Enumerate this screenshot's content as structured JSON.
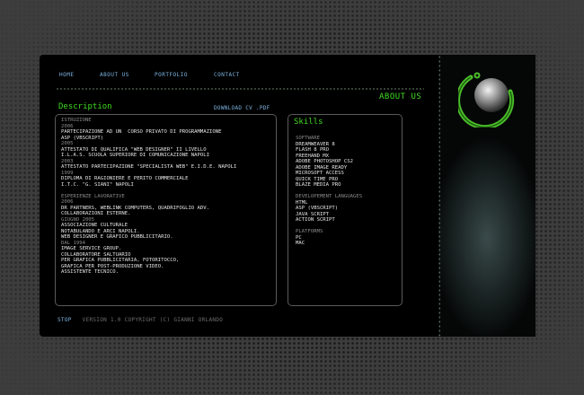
{
  "nav": {
    "items": [
      "HOME",
      "ABOUT US",
      "PORTFOLIO",
      "CONTACT"
    ]
  },
  "section_title": "ABOUT US",
  "description": {
    "title": "Description",
    "download_label": "DOWNLOAD CV .PDF",
    "lines": [
      {
        "text": "ISTRUZIONE",
        "muted": true
      },
      {
        "text": "2006",
        "muted": true
      },
      {
        "text": "PARTECIPAZIONE AD UN  CORSO PRIVATO DI PROGRAMMAZIONE",
        "muted": false
      },
      {
        "text": "ASP (VBSCRIPT)",
        "muted": false
      },
      {
        "text": "2005",
        "muted": true
      },
      {
        "text": "ATTESTATO DI QUALIFICA \"WEB DESIGNER\" II LIVELLO",
        "muted": false
      },
      {
        "text": "I.L.A.S. SCUOLA SUPERIORE DI COMUNICAZIONE NAPOLI",
        "muted": false
      },
      {
        "text": "2003",
        "muted": true
      },
      {
        "text": "ATTESTATO PARTECIPAZIONE \"SPECIALISTA WEB\" E.I.D.E. NAPOLI",
        "muted": false
      },
      {
        "text": "1999",
        "muted": true
      },
      {
        "text": "DIPLOMA DI RAGIONIERE E PERITO COMMERCIALE",
        "muted": false
      },
      {
        "text": "I.T.C. \"G. SIANI\" NAPOLI",
        "muted": false
      },
      {
        "text": "",
        "muted": false
      },
      {
        "text": "ESPERIENZE LAVORATIVE",
        "muted": true
      },
      {
        "text": "2006",
        "muted": true
      },
      {
        "text": "DR PARTNERS, WEBLINK COMPUTERS, QUADRIFOGLIO ADV.",
        "muted": false
      },
      {
        "text": "COLLABORAZIONI ESTERNE.",
        "muted": false
      },
      {
        "text": "GIUGNO 2005",
        "muted": true
      },
      {
        "text": "ASSOCIAZIONE CULTURALE",
        "muted": false
      },
      {
        "text": "NOTABULANDO E ARCI NAPOLI.",
        "muted": false
      },
      {
        "text": "WEB DESIGNER E GRAFICO PUBBLICITARIO.",
        "muted": false
      },
      {
        "text": "DAL 1994",
        "muted": true
      },
      {
        "text": "IMAGE SERVICE GROUP.",
        "muted": false
      },
      {
        "text": "COLLABORATORE SALTUARIO",
        "muted": false
      },
      {
        "text": "PER GRAFICA PUBBLICITARIA, FOTORITOCCO,",
        "muted": false
      },
      {
        "text": "GRAFICA PER POST-PRODUZIONE VIDEO.",
        "muted": false
      },
      {
        "text": "ASSISTENTE TECNICO.",
        "muted": false
      }
    ]
  },
  "skills": {
    "title": "Skills",
    "lines": [
      {
        "text": "SOFTWARE",
        "muted": true
      },
      {
        "text": "DREAMWEAVER 8",
        "muted": false
      },
      {
        "text": "FLASH 8 PRO",
        "muted": false
      },
      {
        "text": "FREEHAND MX",
        "muted": false
      },
      {
        "text": "ADOBE PHOTOSHOP CS2",
        "muted": false
      },
      {
        "text": "ADOBE IMAGE READY",
        "muted": false
      },
      {
        "text": "MICROSOFT ACCESS",
        "muted": false
      },
      {
        "text": "QUICK TIME PRO",
        "muted": false
      },
      {
        "text": "BLAZE MEDIA PRO",
        "muted": false
      },
      {
        "text": "",
        "muted": false
      },
      {
        "text": "DEVELOPEMENT LANGUAGES",
        "muted": true
      },
      {
        "text": "HTML",
        "muted": false
      },
      {
        "text": "ASP (VBSCRIPT)",
        "muted": false
      },
      {
        "text": "JAVA SCRIPT",
        "muted": false
      },
      {
        "text": "ACTION SCRIPT",
        "muted": false
      },
      {
        "text": "",
        "muted": false
      },
      {
        "text": "PLATFORMS",
        "muted": true
      },
      {
        "text": "PC",
        "muted": false
      },
      {
        "text": "MAC",
        "muted": false
      }
    ]
  },
  "footer": {
    "stop_label": "STOP",
    "copyright": "VERSION 1.0 COPYRIGHT (C) GIANNI ORLANDO"
  },
  "colors": {
    "accent_green": "#3fdc1f",
    "link_blue": "#7db3e0",
    "muted_text": "#8a8a8a",
    "body_text": "#e4e4e4"
  },
  "icons": {
    "logo": "sphere-orbit-logo-icon"
  }
}
